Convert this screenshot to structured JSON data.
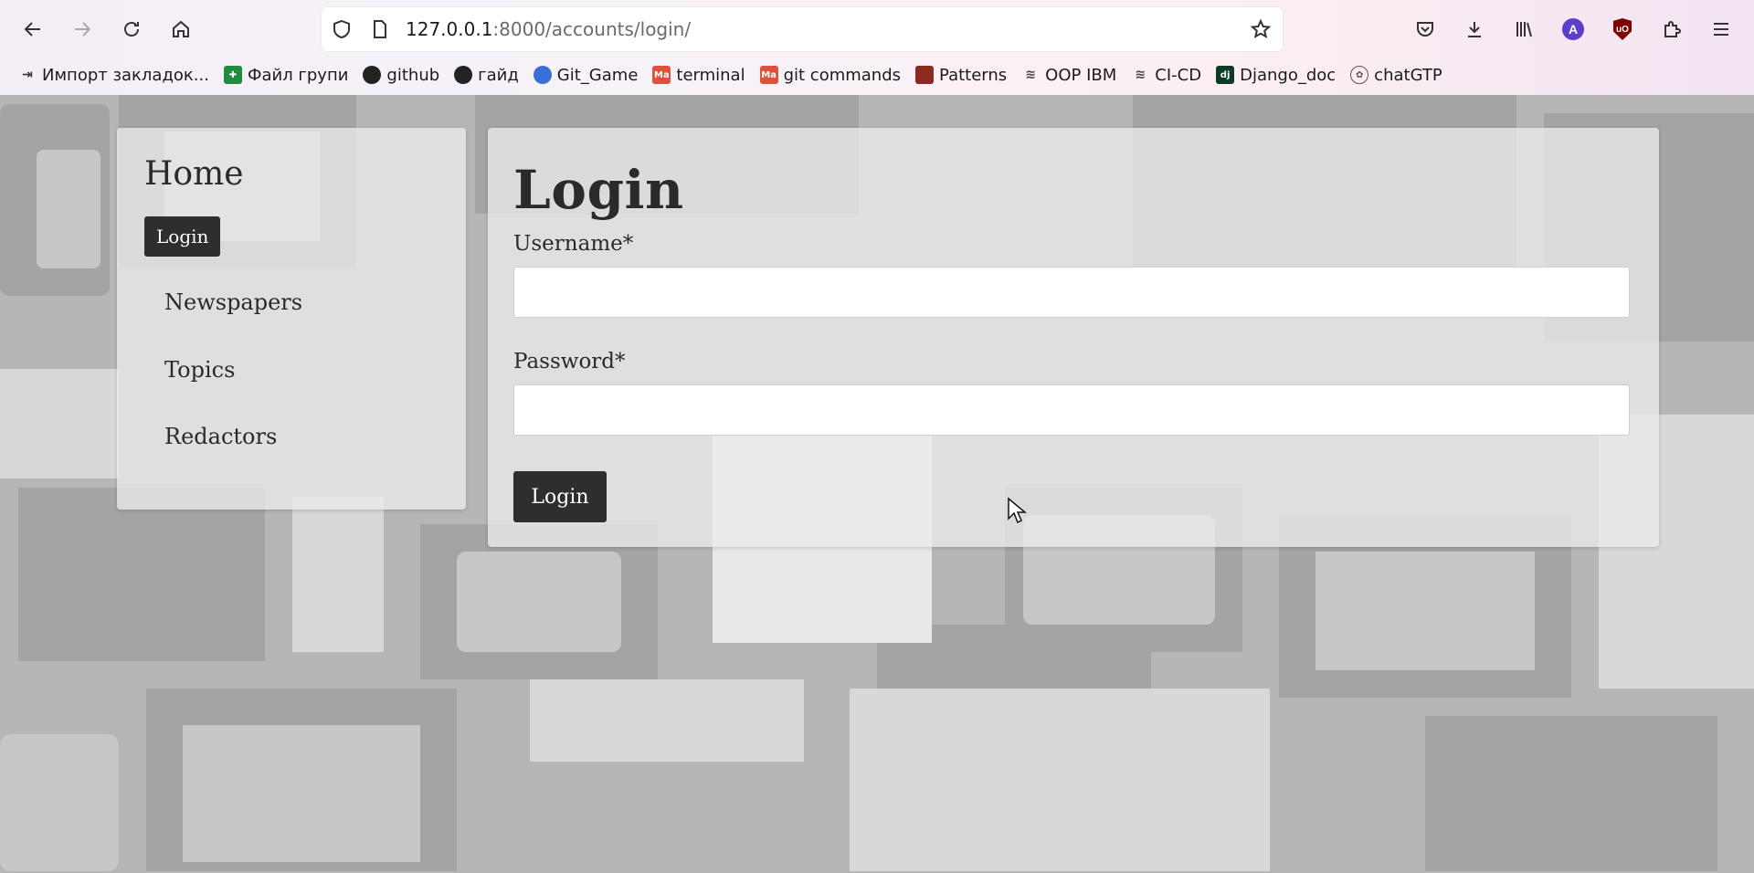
{
  "browser": {
    "url_host": "127.0.0.1",
    "url_rest": ":8000/accounts/login/",
    "bookmarks": [
      {
        "label": "Импорт закладок...",
        "icon": "import-icon"
      },
      {
        "label": "Файл групи",
        "icon": "sheets-icon"
      },
      {
        "label": "github",
        "icon": "github-icon"
      },
      {
        "label": "гайд",
        "icon": "github-icon"
      },
      {
        "label": "Git_Game",
        "icon": "git-game-icon"
      },
      {
        "label": "terminal",
        "icon": "ma-icon"
      },
      {
        "label": "git commands",
        "icon": "ma-icon"
      },
      {
        "label": "Patterns",
        "icon": "patterns-icon"
      },
      {
        "label": "OOP IBM",
        "icon": "ibm-icon"
      },
      {
        "label": "CI-CD",
        "icon": "ibm-icon"
      },
      {
        "label": "Django_doc",
        "icon": "django-icon"
      },
      {
        "label": "chatGTP",
        "icon": "openai-icon"
      }
    ],
    "avatar_letter": "A",
    "ublock_text": "uO"
  },
  "sidebar": {
    "home": "Home",
    "login": "Login",
    "links": [
      "Newspapers",
      "Topics",
      "Redactors"
    ]
  },
  "form": {
    "title": "Login",
    "username_label": "Username*",
    "password_label": "Password*",
    "submit_label": "Login"
  },
  "colors": {
    "button_dark": "#2e2e2e",
    "panel": "#ebebeb",
    "avatar": "#5b3fc9"
  }
}
